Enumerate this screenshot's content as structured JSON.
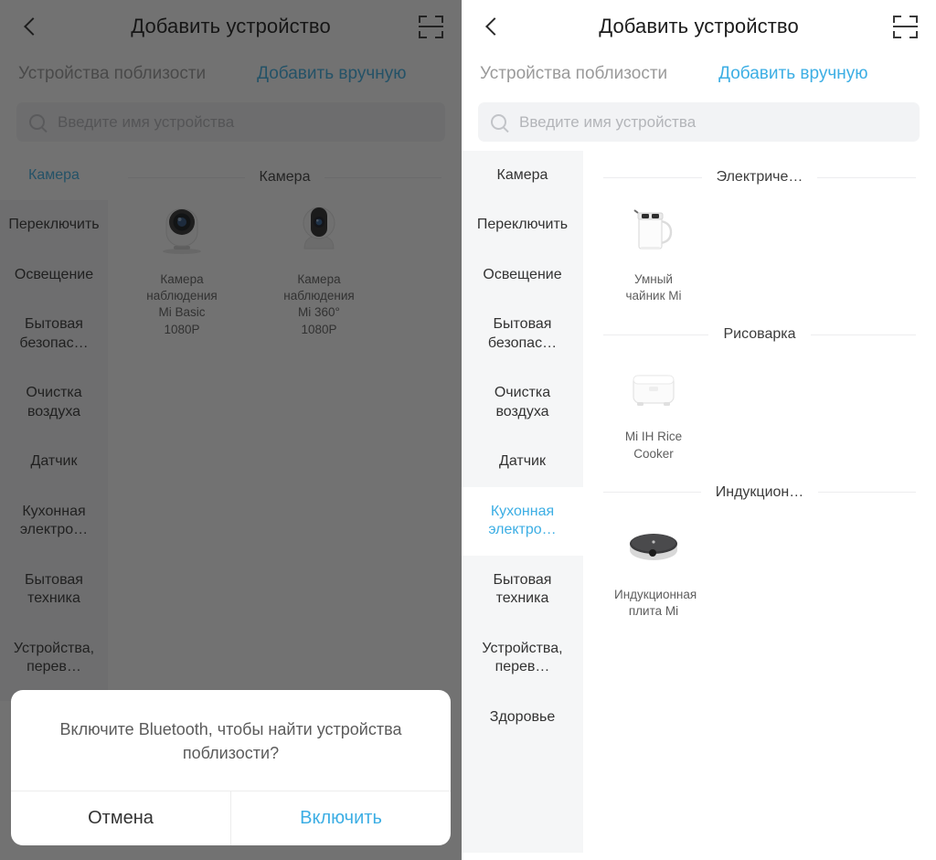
{
  "header": {
    "title": "Добавить устройство",
    "back_icon": "back-chevron-icon",
    "scan_icon": "scan-qr-icon"
  },
  "tabs": {
    "nearby": "Устройства поблизости",
    "manual": "Добавить вручную",
    "active": "manual"
  },
  "search": {
    "placeholder": "Введите имя устройства",
    "value": "",
    "icon": "search-icon"
  },
  "colors": {
    "accent": "#3caee4",
    "sidebar_bg": "#f5f6f7",
    "search_bg": "#f2f3f5",
    "text_primary": "#333333",
    "text_muted": "#9a9a9a",
    "overlay": "rgba(20,20,20,0.60)"
  },
  "left_screen": {
    "categories": [
      {
        "label": "Камера",
        "active": true
      },
      {
        "label": "Переключить",
        "active": false
      },
      {
        "label": "Освещение",
        "active": false
      },
      {
        "label": "Бытовая безопас…",
        "active": false
      },
      {
        "label": "Очистка воздуха",
        "active": false
      },
      {
        "label": "Датчик",
        "active": false
      },
      {
        "label": "Кухонная электро…",
        "active": false
      },
      {
        "label": "Бытовая техника",
        "active": false
      },
      {
        "label": "Устройства, перев…",
        "active": false
      }
    ],
    "sections": [
      {
        "title": "Камера",
        "devices": [
          {
            "name": "Камера наблюдения Mi Basic 1080P",
            "art": "camera-basic-icon"
          },
          {
            "name": "Камера наблюдения Mi 360° 1080P",
            "art": "camera-360-icon"
          }
        ]
      }
    ],
    "dialog": {
      "message": "Включите Bluetooth, чтобы найти устройства поблизости?",
      "cancel": "Отмена",
      "confirm": "Включить"
    }
  },
  "right_screen": {
    "categories": [
      {
        "label": "Камера",
        "active": false
      },
      {
        "label": "Переключить",
        "active": false
      },
      {
        "label": "Освещение",
        "active": false
      },
      {
        "label": "Бытовая безопас…",
        "active": false
      },
      {
        "label": "Очистка воздуха",
        "active": false
      },
      {
        "label": "Датчик",
        "active": false
      },
      {
        "label": "Кухонная электро…",
        "active": true
      },
      {
        "label": "Бытовая техника",
        "active": false
      },
      {
        "label": "Устройства, перев…",
        "active": false
      },
      {
        "label": "Здоровье",
        "active": false
      }
    ],
    "sections": [
      {
        "title": "Электриче…",
        "devices": [
          {
            "name": "Умный чайник Mi",
            "art": "kettle-icon"
          }
        ]
      },
      {
        "title": "Рисоварка",
        "devices": [
          {
            "name": "Mi IH Rice Cooker",
            "art": "rice-cooker-icon"
          }
        ]
      },
      {
        "title": "Индукцион…",
        "devices": [
          {
            "name": "Индукционная плита Mi",
            "art": "induction-cooker-icon"
          }
        ]
      }
    ]
  }
}
